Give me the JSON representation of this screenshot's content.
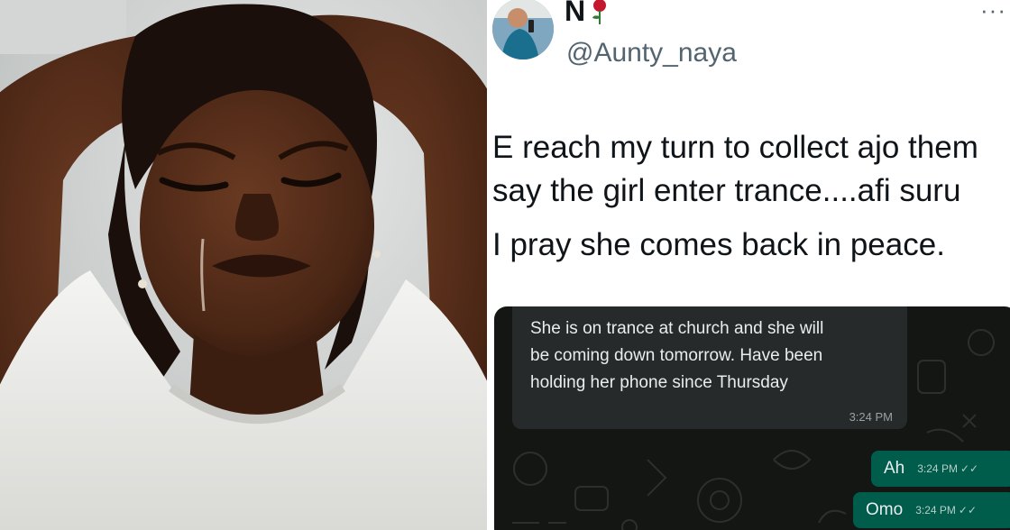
{
  "tweet": {
    "name": "N",
    "handle": "@Aunty_naya",
    "more": "···",
    "lines": [
      "E reach my turn to collect ajo them",
      "say the girl enter trance....afi suru",
      "I pray she comes back in peace."
    ]
  },
  "chat": {
    "incoming": {
      "lines": [
        "She is on trance at church and she will",
        "be coming down tomorrow.  Have been",
        "holding her phone since Thursday"
      ],
      "time": "3:24 PM"
    },
    "outgoing": [
      {
        "text": "Ah",
        "time": "3:24 PM",
        "ticks": "✓✓"
      },
      {
        "text": "Omo",
        "time": "3:24 PM",
        "ticks": "✓✓"
      }
    ]
  },
  "colors": {
    "tweet_text": "#0f1419",
    "handle": "#536471",
    "chat_bg": "#141614",
    "incoming_bubble": "#262a2b",
    "outgoing_bubble": "#005c4b"
  },
  "icons": [
    "rose-emoji-icon",
    "more-options-icon",
    "double-check-icon"
  ]
}
